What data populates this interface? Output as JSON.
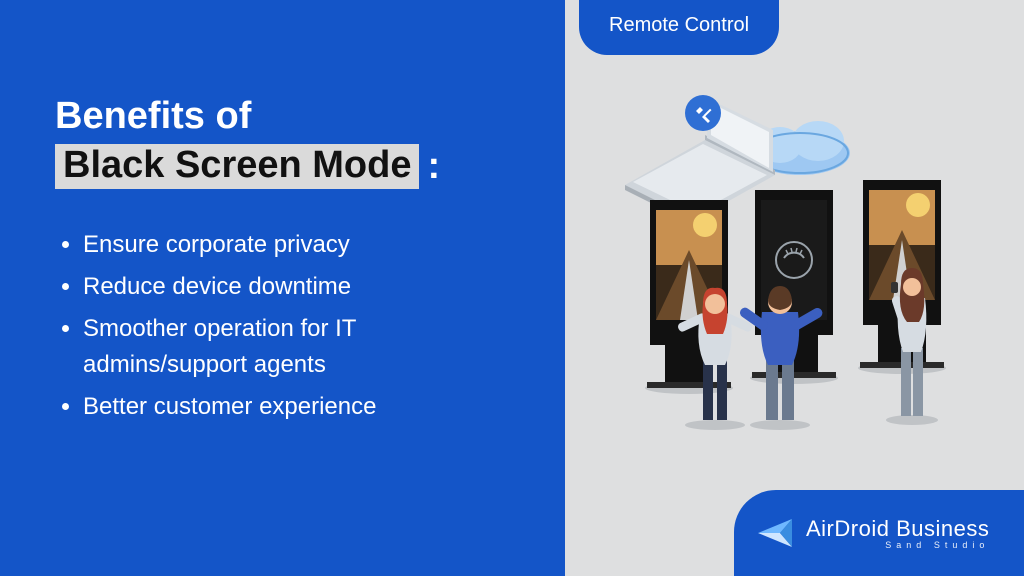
{
  "header": {
    "topTab": "Remote Control"
  },
  "title": {
    "line1": "Benefits of",
    "line2": "Black Screen Mode",
    "colon": ":"
  },
  "bullets": [
    "Ensure corporate privacy",
    "Reduce device downtime",
    "Smoother operation for IT admins/support agents",
    "Better customer experience"
  ],
  "brand": {
    "name": "AirDroid Business",
    "sub": "Sand Studio"
  },
  "colors": {
    "primary": "#1455c8",
    "panelBg": "#dedfe0",
    "highlightBg": "#dadada"
  }
}
